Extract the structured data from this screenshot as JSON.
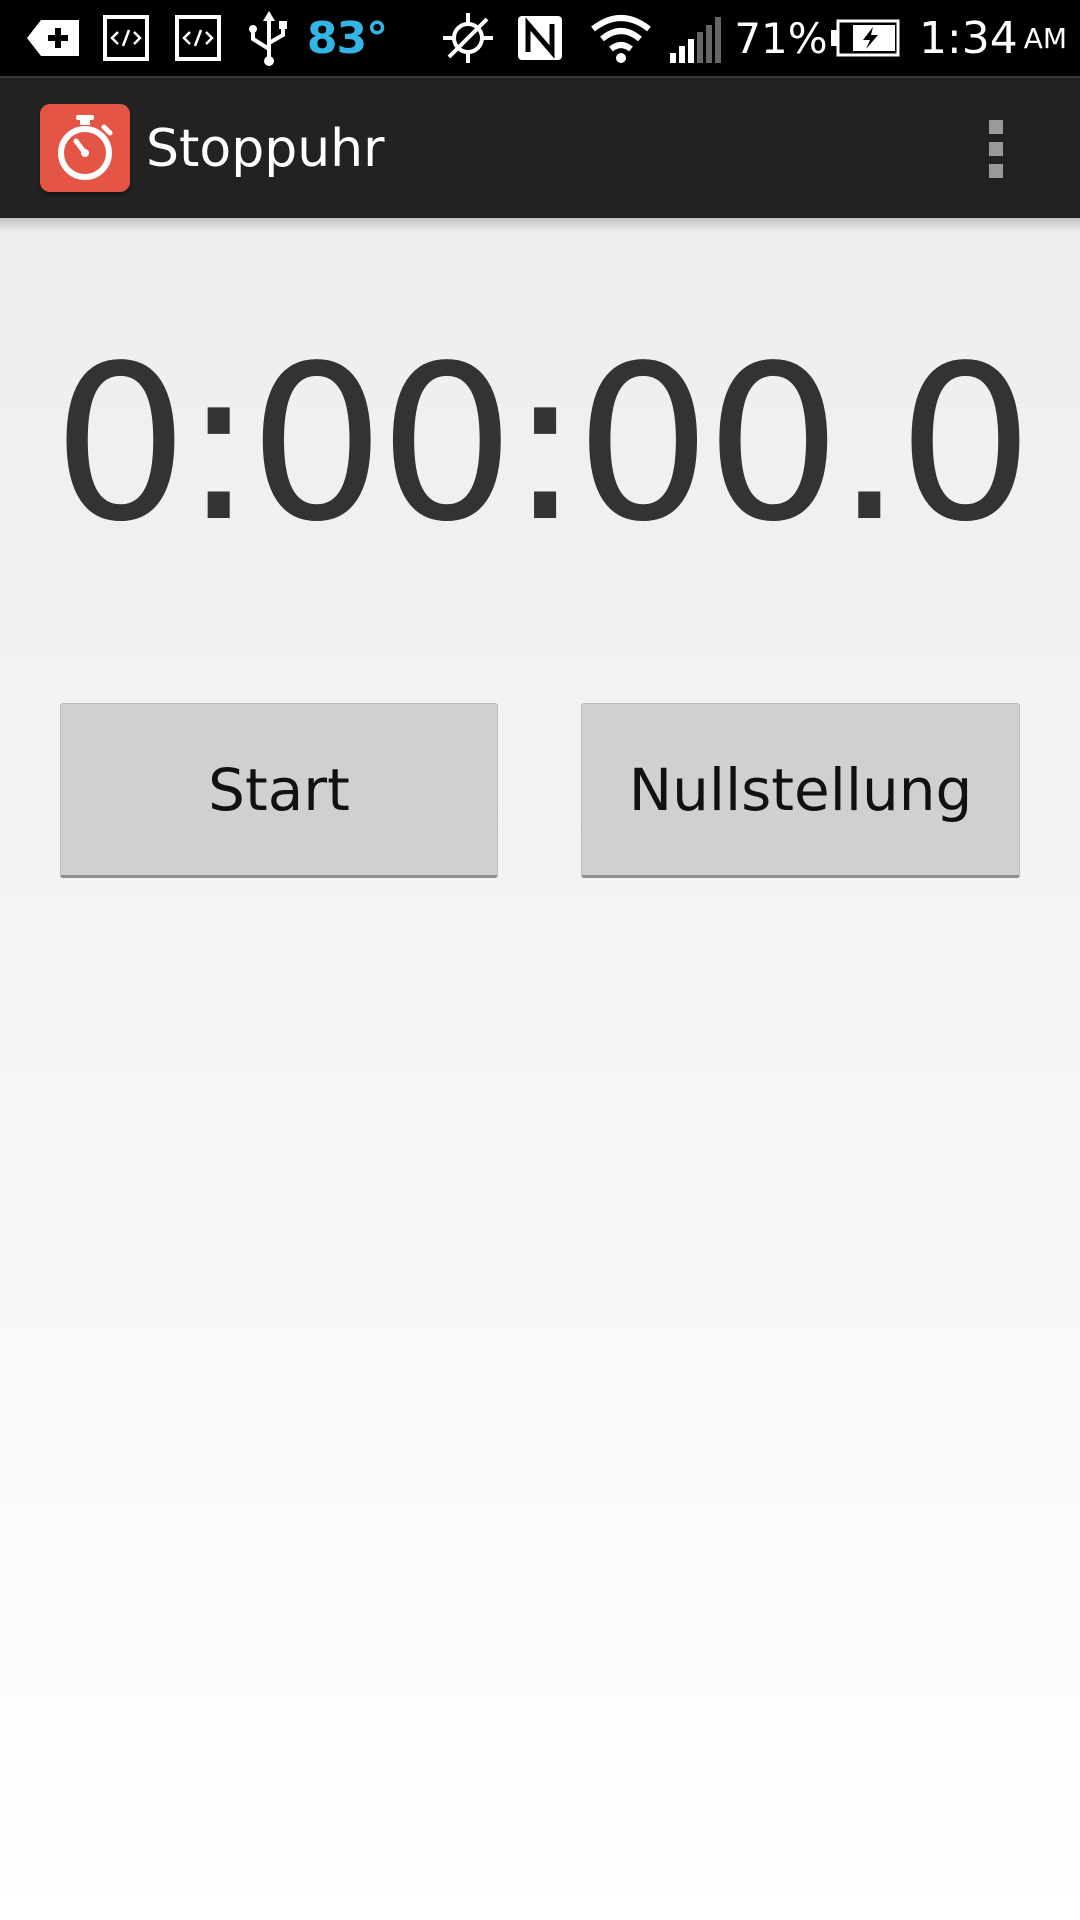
{
  "status_bar": {
    "icons": [
      "add-notification-icon",
      "code-icon",
      "code-icon",
      "usb-icon",
      "location-off-icon",
      "nfc-icon",
      "wifi-icon",
      "signal-icon",
      "battery-charging-icon"
    ],
    "temperature": "83°",
    "temperature_color": "#33b5e5",
    "battery_percent": "71%",
    "time": "1:34",
    "ampm": "AM"
  },
  "action_bar": {
    "app_icon": "stopwatch-icon",
    "app_icon_color": "#e55545",
    "title": "Stoppuhr",
    "overflow_icon": "overflow-menu-icon"
  },
  "timer": {
    "display": "0:00:00.0"
  },
  "buttons": {
    "start_label": "Start",
    "reset_label": "Nullstellung"
  }
}
